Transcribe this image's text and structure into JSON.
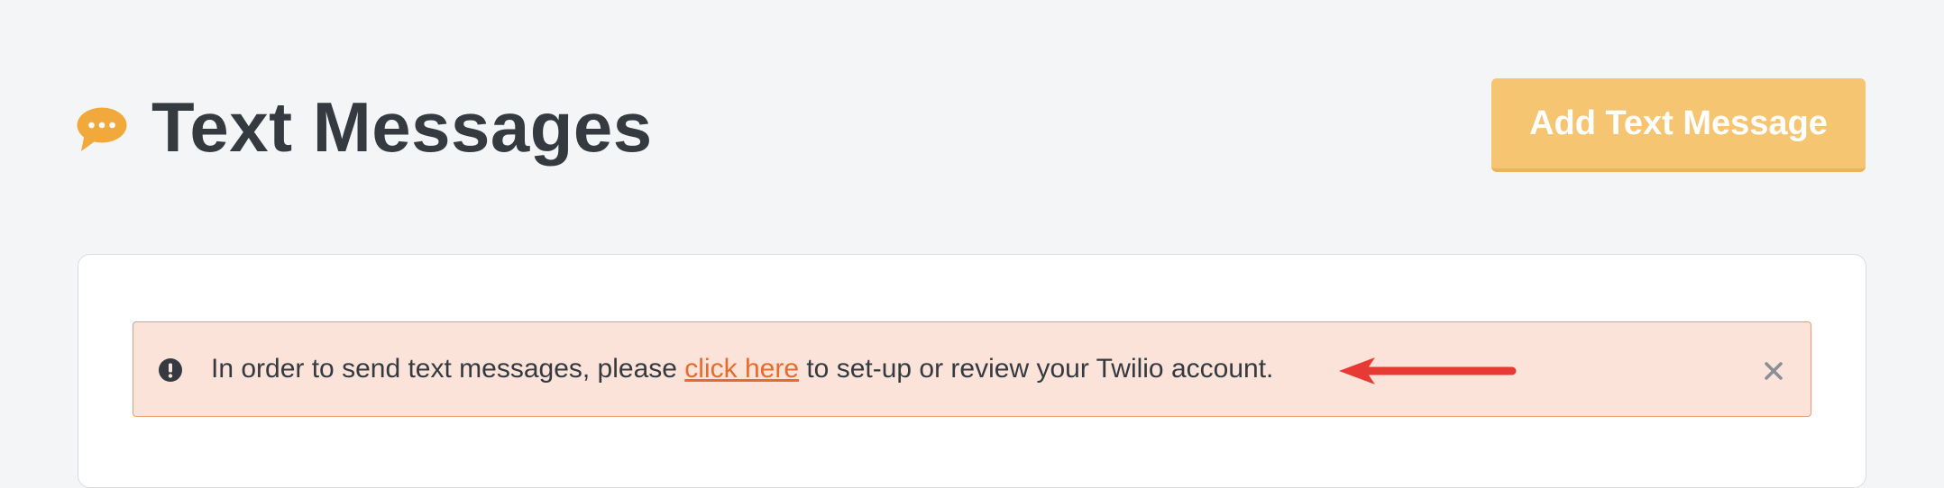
{
  "header": {
    "title": "Text Messages",
    "title_icon": "speech-bubble-dots-icon",
    "add_button_label": "Add Text Message"
  },
  "alert": {
    "icon": "exclamation-circle-icon",
    "text_before": "In order to send text messages, please ",
    "link_text": "click here",
    "text_after": " to set-up or review your Twilio account.",
    "annotation_icon": "red-arrow-icon",
    "close_icon": "close-icon"
  },
  "colors": {
    "accent": "#f5c572",
    "icon_orange": "#f2a93b",
    "alert_background": "#fbe3da",
    "alert_border": "#eb9a74",
    "link": "#e86a2c",
    "annotation_arrow": "#e83a35"
  }
}
